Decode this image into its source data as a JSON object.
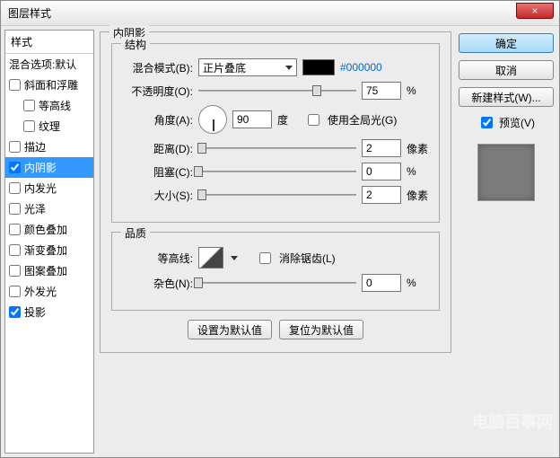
{
  "window": {
    "title": "图层样式",
    "close": "×"
  },
  "left": {
    "header": "样式",
    "blend_opts": "混合选项:默认",
    "items": [
      {
        "label": "斜面和浮雕",
        "checked": false,
        "sub": false
      },
      {
        "label": "等高线",
        "checked": false,
        "sub": true
      },
      {
        "label": "纹理",
        "checked": false,
        "sub": true
      },
      {
        "label": "描边",
        "checked": false,
        "sub": false
      },
      {
        "label": "内阴影",
        "checked": true,
        "sub": false,
        "selected": true
      },
      {
        "label": "内发光",
        "checked": false,
        "sub": false
      },
      {
        "label": "光泽",
        "checked": false,
        "sub": false
      },
      {
        "label": "颜色叠加",
        "checked": false,
        "sub": false
      },
      {
        "label": "渐变叠加",
        "checked": false,
        "sub": false
      },
      {
        "label": "图案叠加",
        "checked": false,
        "sub": false
      },
      {
        "label": "外发光",
        "checked": false,
        "sub": false
      },
      {
        "label": "投影",
        "checked": true,
        "sub": false
      }
    ]
  },
  "panel": {
    "title": "内阴影",
    "struct_legend": "结构",
    "blend_mode_label": "混合模式(B):",
    "blend_mode_value": "正片叠底",
    "color_hex": "#000000",
    "opacity_label": "不透明度(O):",
    "opacity_value": "75",
    "opacity_unit": "%",
    "angle_label": "角度(A):",
    "angle_value": "90",
    "angle_unit": "度",
    "global_light_label": "使用全局光(G)",
    "global_light_checked": false,
    "distance_label": "距离(D):",
    "distance_value": "2",
    "distance_unit": "像素",
    "choke_label": "阻塞(C):",
    "choke_value": "0",
    "choke_unit": "%",
    "size_label": "大小(S):",
    "size_value": "2",
    "size_unit": "像素",
    "quality_legend": "品质",
    "contour_label": "等高线:",
    "antialias_label": "消除锯齿(L)",
    "noise_label": "杂色(N):",
    "noise_value": "0",
    "noise_unit": "%",
    "make_default": "设置为默认值",
    "reset_default": "复位为默认值"
  },
  "right": {
    "ok": "确定",
    "cancel": "取消",
    "new_style": "新建样式(W)...",
    "preview_label": "预览(V)",
    "preview_checked": true
  },
  "watermark": "电脑百事网"
}
